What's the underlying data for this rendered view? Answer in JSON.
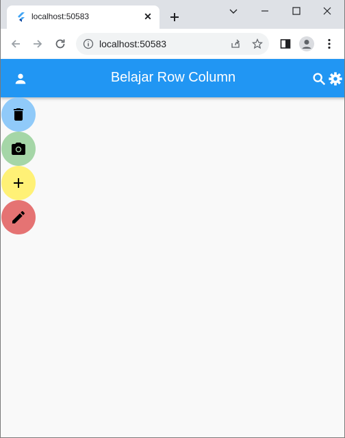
{
  "browser": {
    "tab_title": "localhost:50583",
    "url": "localhost:50583"
  },
  "app": {
    "title": "Belajar Row Column",
    "appbar_color": "#2196f3",
    "leading_icon": "person-icon",
    "actions": [
      "search-icon",
      "settings-icon"
    ]
  },
  "fabs": [
    {
      "icon": "delete-icon",
      "color": "#90caf9"
    },
    {
      "icon": "camera-icon",
      "color": "#a5d6a7"
    },
    {
      "icon": "add-icon",
      "color": "#fff176"
    },
    {
      "icon": "edit-icon",
      "color": "#e57373"
    }
  ]
}
